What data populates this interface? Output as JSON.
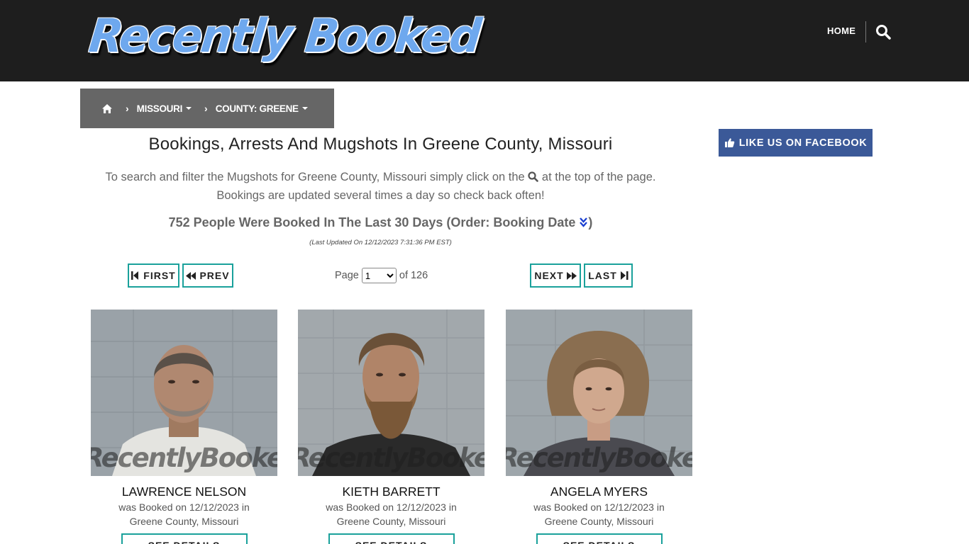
{
  "site": {
    "logo_text": "Recently Booked"
  },
  "nav": {
    "home": "HOME"
  },
  "breadcrumb": {
    "state": "MISSOURI",
    "county": "COUNTY: GREENE"
  },
  "facebook": {
    "label": "LIKE US ON FACEBOOK"
  },
  "main": {
    "title": "Bookings, Arrests And Mugshots In Greene County, Missouri",
    "intro_a": "To search and filter the Mugshots for Greene County, Missouri simply click on the",
    "intro_b": "at the top of the page.",
    "intro_c": "Bookings are updated several times a day so check back often!",
    "count_text": "752 People Were Booked In The Last 30 Days (Order: Booking Date",
    "count_close": ")",
    "updated": "(Last Updated On 12/12/2023 7:31:36 PM EST)"
  },
  "pagination": {
    "first": "FIRST",
    "prev": "PREV",
    "next": "NEXT",
    "last": "LAST",
    "page_label": "Page",
    "current_page": "1",
    "of_label": "of 126"
  },
  "watermark": "RecentlyBooked.com",
  "bookings": [
    {
      "name": "LAWRENCE NELSON",
      "line1": "was Booked on 12/12/2023 in",
      "line2": "Greene County, Missouri",
      "button": "SEE DETAILS"
    },
    {
      "name": "KIETH BARRETT",
      "line1": "was Booked on 12/12/2023 in",
      "line2": "Greene County, Missouri",
      "button": "SEE DETAILS"
    },
    {
      "name": "ANGELA MYERS",
      "line1": "was Booked on 12/12/2023 in",
      "line2": "Greene County, Missouri",
      "button": "SEE DETAILS"
    }
  ],
  "colors": {
    "header_bg": "#1e1e1e",
    "breadcrumb_bg": "#666666",
    "accent_teal": "#1aa19b",
    "facebook_blue": "#3b5998"
  }
}
